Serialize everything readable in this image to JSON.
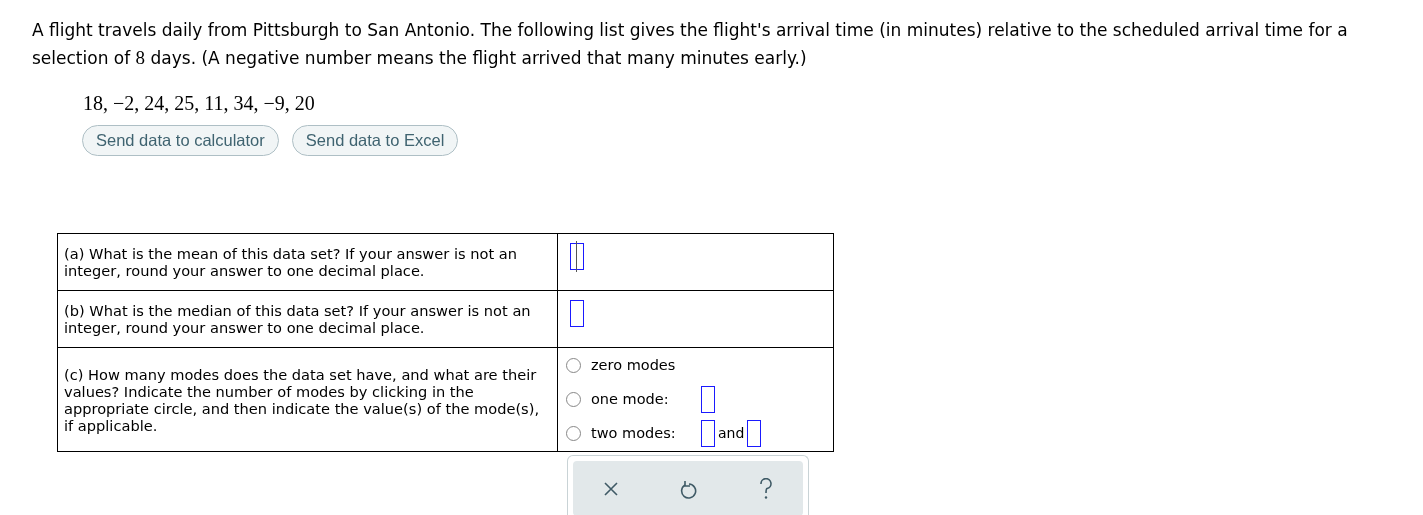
{
  "intro": [
    {
      "kind": "text",
      "text": "A flight travels daily from Pittsburgh to San Antonio. The following list gives the flight's arrival time (in minutes) relative to the scheduled arrival time for a selection of "
    },
    {
      "kind": "math",
      "text": "8"
    },
    {
      "kind": "text",
      "text": " days. (A negative number means the flight arrived that many minutes early.)"
    }
  ],
  "data_list": "18, −2, 24, 25, 11, 34, −9, 20",
  "buttons": [
    "Send data to calculator",
    "Send data to Excel"
  ],
  "questions": [
    {
      "kind": "field",
      "prompt": "(a) What is the mean of this data set? If your answer is not an integer, round your answer to one decimal place.",
      "focused": true
    },
    {
      "kind": "field",
      "prompt": "(b) What is the median of this data set? If your answer is not an integer, round your answer to one decimal place.",
      "focused": false
    },
    {
      "kind": "choice",
      "prompt": "(c) How many modes does the data set have, and what are their values? Indicate the number of modes by clicking in the appropriate circle, and then indicate the value(s) of the mode(s), if applicable.",
      "options": [
        {
          "label": "zero modes",
          "kind": "none",
          "selected": false
        },
        {
          "label": "one mode:",
          "kind": "single",
          "selected": false
        },
        {
          "label": "two modes:",
          "kind": "pair",
          "joiner": "and",
          "selected": false
        }
      ]
    }
  ]
}
